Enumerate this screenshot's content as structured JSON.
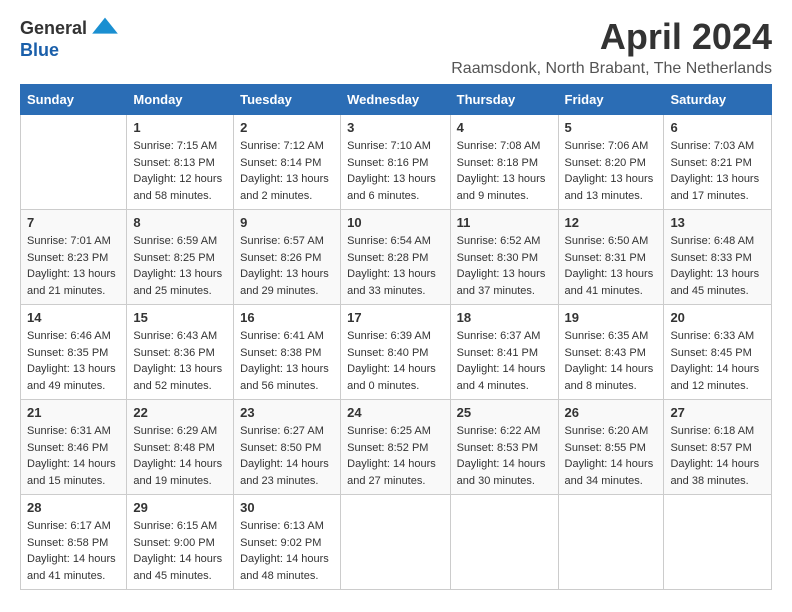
{
  "header": {
    "logo_general": "General",
    "logo_blue": "Blue",
    "month_title": "April 2024",
    "subtitle": "Raamsdonk, North Brabant, The Netherlands"
  },
  "days_of_week": [
    "Sunday",
    "Monday",
    "Tuesday",
    "Wednesday",
    "Thursday",
    "Friday",
    "Saturday"
  ],
  "weeks": [
    [
      {
        "day": "",
        "sunrise": "",
        "sunset": "",
        "daylight": ""
      },
      {
        "day": "1",
        "sunrise": "Sunrise: 7:15 AM",
        "sunset": "Sunset: 8:13 PM",
        "daylight": "Daylight: 12 hours and 58 minutes."
      },
      {
        "day": "2",
        "sunrise": "Sunrise: 7:12 AM",
        "sunset": "Sunset: 8:14 PM",
        "daylight": "Daylight: 13 hours and 2 minutes."
      },
      {
        "day": "3",
        "sunrise": "Sunrise: 7:10 AM",
        "sunset": "Sunset: 8:16 PM",
        "daylight": "Daylight: 13 hours and 6 minutes."
      },
      {
        "day": "4",
        "sunrise": "Sunrise: 7:08 AM",
        "sunset": "Sunset: 8:18 PM",
        "daylight": "Daylight: 13 hours and 9 minutes."
      },
      {
        "day": "5",
        "sunrise": "Sunrise: 7:06 AM",
        "sunset": "Sunset: 8:20 PM",
        "daylight": "Daylight: 13 hours and 13 minutes."
      },
      {
        "day": "6",
        "sunrise": "Sunrise: 7:03 AM",
        "sunset": "Sunset: 8:21 PM",
        "daylight": "Daylight: 13 hours and 17 minutes."
      }
    ],
    [
      {
        "day": "7",
        "sunrise": "Sunrise: 7:01 AM",
        "sunset": "Sunset: 8:23 PM",
        "daylight": "Daylight: 13 hours and 21 minutes."
      },
      {
        "day": "8",
        "sunrise": "Sunrise: 6:59 AM",
        "sunset": "Sunset: 8:25 PM",
        "daylight": "Daylight: 13 hours and 25 minutes."
      },
      {
        "day": "9",
        "sunrise": "Sunrise: 6:57 AM",
        "sunset": "Sunset: 8:26 PM",
        "daylight": "Daylight: 13 hours and 29 minutes."
      },
      {
        "day": "10",
        "sunrise": "Sunrise: 6:54 AM",
        "sunset": "Sunset: 8:28 PM",
        "daylight": "Daylight: 13 hours and 33 minutes."
      },
      {
        "day": "11",
        "sunrise": "Sunrise: 6:52 AM",
        "sunset": "Sunset: 8:30 PM",
        "daylight": "Daylight: 13 hours and 37 minutes."
      },
      {
        "day": "12",
        "sunrise": "Sunrise: 6:50 AM",
        "sunset": "Sunset: 8:31 PM",
        "daylight": "Daylight: 13 hours and 41 minutes."
      },
      {
        "day": "13",
        "sunrise": "Sunrise: 6:48 AM",
        "sunset": "Sunset: 8:33 PM",
        "daylight": "Daylight: 13 hours and 45 minutes."
      }
    ],
    [
      {
        "day": "14",
        "sunrise": "Sunrise: 6:46 AM",
        "sunset": "Sunset: 8:35 PM",
        "daylight": "Daylight: 13 hours and 49 minutes."
      },
      {
        "day": "15",
        "sunrise": "Sunrise: 6:43 AM",
        "sunset": "Sunset: 8:36 PM",
        "daylight": "Daylight: 13 hours and 52 minutes."
      },
      {
        "day": "16",
        "sunrise": "Sunrise: 6:41 AM",
        "sunset": "Sunset: 8:38 PM",
        "daylight": "Daylight: 13 hours and 56 minutes."
      },
      {
        "day": "17",
        "sunrise": "Sunrise: 6:39 AM",
        "sunset": "Sunset: 8:40 PM",
        "daylight": "Daylight: 14 hours and 0 minutes."
      },
      {
        "day": "18",
        "sunrise": "Sunrise: 6:37 AM",
        "sunset": "Sunset: 8:41 PM",
        "daylight": "Daylight: 14 hours and 4 minutes."
      },
      {
        "day": "19",
        "sunrise": "Sunrise: 6:35 AM",
        "sunset": "Sunset: 8:43 PM",
        "daylight": "Daylight: 14 hours and 8 minutes."
      },
      {
        "day": "20",
        "sunrise": "Sunrise: 6:33 AM",
        "sunset": "Sunset: 8:45 PM",
        "daylight": "Daylight: 14 hours and 12 minutes."
      }
    ],
    [
      {
        "day": "21",
        "sunrise": "Sunrise: 6:31 AM",
        "sunset": "Sunset: 8:46 PM",
        "daylight": "Daylight: 14 hours and 15 minutes."
      },
      {
        "day": "22",
        "sunrise": "Sunrise: 6:29 AM",
        "sunset": "Sunset: 8:48 PM",
        "daylight": "Daylight: 14 hours and 19 minutes."
      },
      {
        "day": "23",
        "sunrise": "Sunrise: 6:27 AM",
        "sunset": "Sunset: 8:50 PM",
        "daylight": "Daylight: 14 hours and 23 minutes."
      },
      {
        "day": "24",
        "sunrise": "Sunrise: 6:25 AM",
        "sunset": "Sunset: 8:52 PM",
        "daylight": "Daylight: 14 hours and 27 minutes."
      },
      {
        "day": "25",
        "sunrise": "Sunrise: 6:22 AM",
        "sunset": "Sunset: 8:53 PM",
        "daylight": "Daylight: 14 hours and 30 minutes."
      },
      {
        "day": "26",
        "sunrise": "Sunrise: 6:20 AM",
        "sunset": "Sunset: 8:55 PM",
        "daylight": "Daylight: 14 hours and 34 minutes."
      },
      {
        "day": "27",
        "sunrise": "Sunrise: 6:18 AM",
        "sunset": "Sunset: 8:57 PM",
        "daylight": "Daylight: 14 hours and 38 minutes."
      }
    ],
    [
      {
        "day": "28",
        "sunrise": "Sunrise: 6:17 AM",
        "sunset": "Sunset: 8:58 PM",
        "daylight": "Daylight: 14 hours and 41 minutes."
      },
      {
        "day": "29",
        "sunrise": "Sunrise: 6:15 AM",
        "sunset": "Sunset: 9:00 PM",
        "daylight": "Daylight: 14 hours and 45 minutes."
      },
      {
        "day": "30",
        "sunrise": "Sunrise: 6:13 AM",
        "sunset": "Sunset: 9:02 PM",
        "daylight": "Daylight: 14 hours and 48 minutes."
      },
      {
        "day": "",
        "sunrise": "",
        "sunset": "",
        "daylight": ""
      },
      {
        "day": "",
        "sunrise": "",
        "sunset": "",
        "daylight": ""
      },
      {
        "day": "",
        "sunrise": "",
        "sunset": "",
        "daylight": ""
      },
      {
        "day": "",
        "sunrise": "",
        "sunset": "",
        "daylight": ""
      }
    ]
  ]
}
